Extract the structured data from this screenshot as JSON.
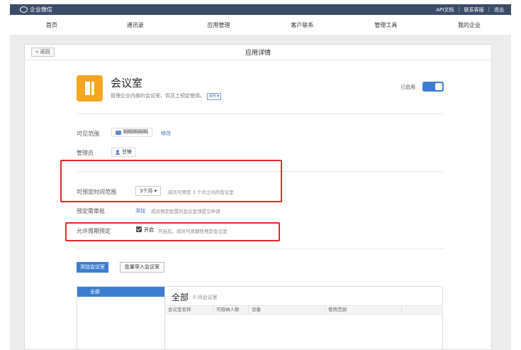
{
  "topbar": {
    "brand": "企业微信",
    "links": [
      "API文档",
      "联系客服",
      "退出"
    ]
  },
  "nav": [
    "首页",
    "通讯录",
    "应用管理",
    "客户联系",
    "管理工具",
    "我的企业"
  ],
  "page": {
    "title": "应用详情",
    "back_label": "« 返回"
  },
  "app": {
    "name": "会议室",
    "description": "管理企业内部的会议室，供员工预定使用。",
    "api_tag": "API ▾",
    "status_label": "已启用",
    "enabled": true
  },
  "visibility": {
    "label": "可见范围",
    "value": "啊啊啊啊啊",
    "edit_label": "修改"
  },
  "admin": {
    "label": "管理员",
    "value": "甘锋"
  },
  "booking_range": {
    "label": "可预定时间范围",
    "value": "3个月 ▾",
    "hint": "成员可预定 3 个月之内的会议室"
  },
  "approval": {
    "label": "预定需审批",
    "action": "添加",
    "hint": "成员预定配置的会议室须提交申请"
  },
  "recurring": {
    "label": "允许周期预定",
    "checked": true,
    "checkbox_label": "开启",
    "hint": "开启后，成员可周期性预定会议室"
  },
  "buttons": {
    "add_room": "添加会议室",
    "batch_import": "批量导入会议室"
  },
  "rooms": {
    "side_active": "全部",
    "title": "全部",
    "count": "0 间会议室",
    "columns": [
      "会议室名称",
      "可容纳人数",
      "设备",
      "使用范围"
    ]
  }
}
